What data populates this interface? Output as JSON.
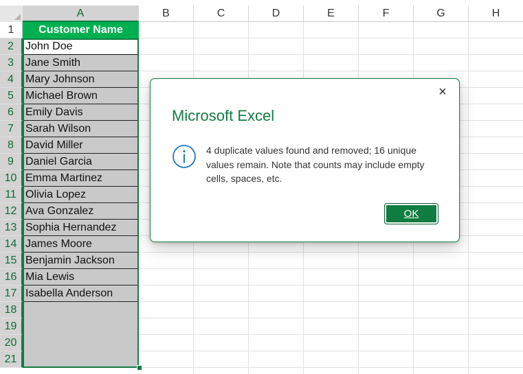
{
  "spreadsheet": {
    "columns": [
      "A",
      "B",
      "C",
      "D",
      "E",
      "F",
      "G",
      "H"
    ],
    "rows": [
      "1",
      "2",
      "3",
      "4",
      "5",
      "6",
      "7",
      "8",
      "9",
      "10",
      "11",
      "12",
      "13",
      "14",
      "15",
      "16",
      "17",
      "18",
      "19",
      "20",
      "21"
    ],
    "header_cell": "Customer Name",
    "names": [
      "John Doe",
      "Jane Smith",
      "Mary Johnson",
      "Michael Brown",
      "Emily Davis",
      "Sarah Wilson",
      "David Miller",
      "Daniel Garcia",
      "Emma Martinez",
      "Olivia Lopez",
      "Ava Gonzalez",
      "Sophia Hernandez",
      "James Moore",
      "Benjamin Jackson",
      "Mia Lewis",
      "Isabella Anderson"
    ],
    "header_color": "#00b050",
    "selection_color": "#107c41"
  },
  "dialog": {
    "title": "Microsoft Excel",
    "message": "4 duplicate values found and removed; 16 unique values remain. Note that counts may include empty cells, spaces, etc.",
    "ok_label": "OK",
    "close_icon": "×",
    "info_icon": "info-icon"
  }
}
